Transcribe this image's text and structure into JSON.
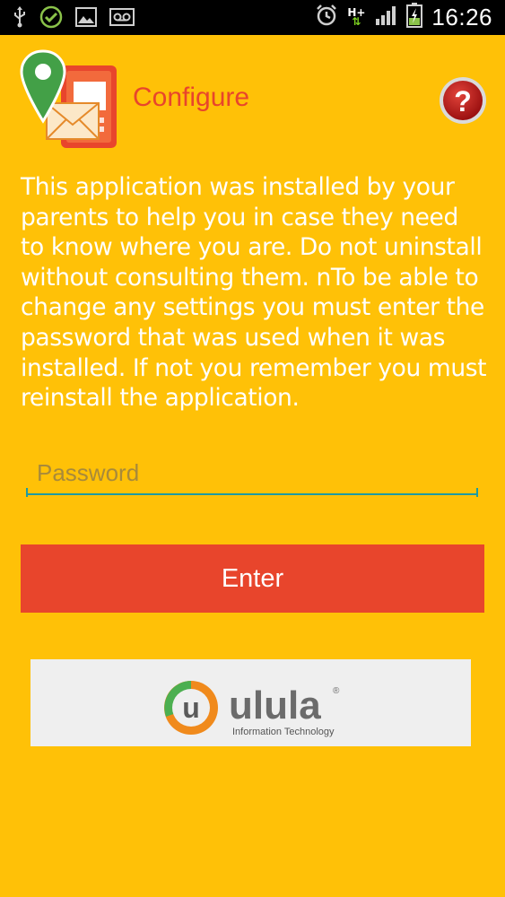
{
  "status_bar": {
    "time": "16:26",
    "network": "H+",
    "icons": [
      "usb-icon",
      "check-circle-icon",
      "image-icon",
      "voicemail-icon",
      "alarm-icon",
      "network-hplus-icon",
      "signal-icon",
      "battery-charging-icon"
    ]
  },
  "header": {
    "title": "Configure",
    "help_symbol": "?"
  },
  "description": "This application was installed by your parents to help you in case they need to know where you are. Do not uninstall without consulting them. nTo be able to change any settings you must enter the password that was used when it was installed. If not you remember you must reinstall the application.",
  "password": {
    "placeholder": "Password",
    "value": ""
  },
  "enter_button": {
    "label": "Enter"
  },
  "sponsor": {
    "brand_name": "ulula",
    "brand_letter": "u",
    "tagline": "Information Technology",
    "registered": "®"
  },
  "colors": {
    "background": "#FFC107",
    "accent": "#E8452C",
    "input_line": "#1E9AA3"
  }
}
